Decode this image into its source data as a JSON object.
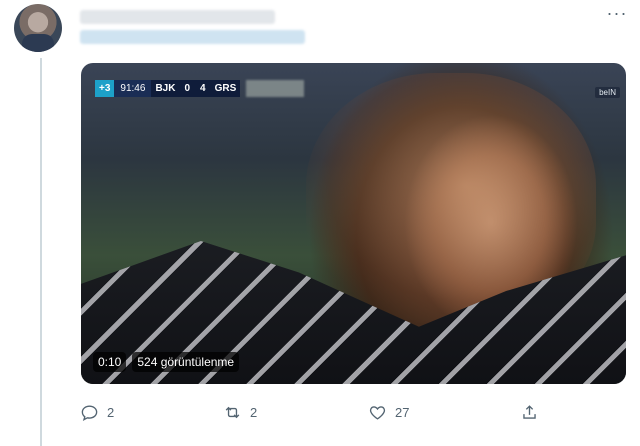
{
  "tweet": {
    "more_label": "···",
    "video": {
      "scoreboard": {
        "stoppage": "+3",
        "clock": "91:46",
        "home_team": "BJK",
        "home_score": "0",
        "away_score": "4",
        "away_team": "GRS"
      },
      "channel_logo": "beIN",
      "duration": "0:10",
      "views": "524 görüntülenme"
    },
    "actions": {
      "reply_count": "2",
      "retweet_count": "2",
      "like_count": "27"
    }
  }
}
